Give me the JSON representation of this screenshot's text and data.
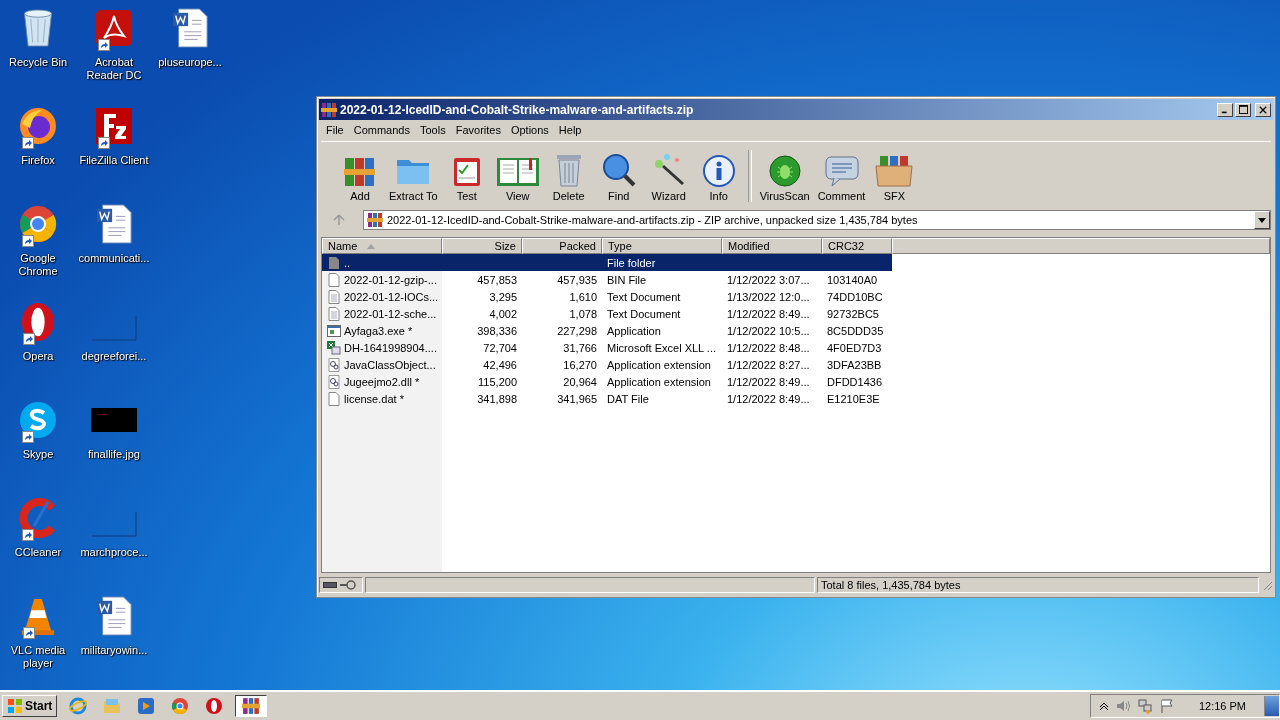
{
  "desktop_icons": [
    {
      "label": "Recycle Bin",
      "kind": "recycle",
      "shortcut": false
    },
    {
      "label": "Firefox",
      "kind": "firefox",
      "shortcut": true
    },
    {
      "label": "Google Chrome",
      "kind": "chrome",
      "shortcut": true
    },
    {
      "label": "Opera",
      "kind": "opera",
      "shortcut": true
    },
    {
      "label": "Skype",
      "kind": "skype",
      "shortcut": true
    },
    {
      "label": "CCleaner",
      "kind": "ccleaner",
      "shortcut": true
    },
    {
      "label": "VLC media player",
      "kind": "vlc",
      "shortcut": true
    },
    {
      "label": "Acrobat Reader DC",
      "kind": "pdf",
      "shortcut": true
    },
    {
      "label": "FileZilla Client",
      "kind": "filezilla",
      "shortcut": true
    },
    {
      "label": "communicati...",
      "kind": "word",
      "shortcut": false
    },
    {
      "label": "degreeforei...",
      "kind": "blank",
      "shortcut": false
    },
    {
      "label": "finallife.jpg",
      "kind": "image",
      "shortcut": false
    },
    {
      "label": "marchproce...",
      "kind": "blank",
      "shortcut": false
    },
    {
      "label": "militaryowin...",
      "kind": "word",
      "shortcut": false
    },
    {
      "label": "pluseurope...",
      "kind": "word",
      "shortcut": false
    }
  ],
  "window": {
    "title": "2022-01-12-IcedID-and-Cobalt-Strike-malware-and-artifacts.zip",
    "menu": [
      "File",
      "Commands",
      "Tools",
      "Favorites",
      "Options",
      "Help"
    ],
    "toolbar": [
      {
        "label": "Add",
        "kind": "add"
      },
      {
        "label": "Extract To",
        "kind": "extract"
      },
      {
        "label": "Test",
        "kind": "test"
      },
      {
        "label": "View",
        "kind": "view"
      },
      {
        "label": "Delete",
        "kind": "delete"
      },
      {
        "label": "Find",
        "kind": "find"
      },
      {
        "label": "Wizard",
        "kind": "wizard"
      },
      {
        "label": "Info",
        "kind": "info"
      },
      {
        "label": "VirusScan",
        "kind": "virus"
      },
      {
        "label": "Comment",
        "kind": "comment"
      },
      {
        "label": "SFX",
        "kind": "sfx"
      }
    ],
    "address": "2022-01-12-IcedID-and-Cobalt-Strike-malware-and-artifacts.zip - ZIP archive, unpacked size 1,435,784 bytes",
    "columns": [
      {
        "label": "Name",
        "sorted": true
      },
      {
        "label": "Size",
        "sorted": false
      },
      {
        "label": "Packed",
        "sorted": false
      },
      {
        "label": "Type",
        "sorted": false
      },
      {
        "label": "Modified",
        "sorted": false
      },
      {
        "label": "CRC32",
        "sorted": false
      }
    ],
    "rows": [
      {
        "kind": "up",
        "name": "..",
        "size": "",
        "packed": "",
        "type": "File folder",
        "modified": "",
        "crc": "",
        "selected": true
      },
      {
        "kind": "file",
        "name": "2022-01-12-gzip-...",
        "size": "457,853",
        "packed": "457,935",
        "type": "BIN File",
        "modified": "1/12/2022 3:07...",
        "crc": "103140A0",
        "selected": false
      },
      {
        "kind": "text",
        "name": "2022-01-12-IOCs...",
        "size": "3,295",
        "packed": "1,610",
        "type": "Text Document",
        "modified": "1/13/2022 12:0...",
        "crc": "74DD10BC",
        "selected": false
      },
      {
        "kind": "text",
        "name": "2022-01-12-sche...",
        "size": "4,002",
        "packed": "1,078",
        "type": "Text Document",
        "modified": "1/12/2022 8:49...",
        "crc": "92732BC5",
        "selected": false
      },
      {
        "kind": "exe",
        "name": "Ayfaga3.exe *",
        "size": "398,336",
        "packed": "227,298",
        "type": "Application",
        "modified": "1/12/2022 10:5...",
        "crc": "8C5DDD35",
        "selected": false
      },
      {
        "kind": "excel",
        "name": "DH-1641998904....",
        "size": "72,704",
        "packed": "31,766",
        "type": "Microsoft Excel XLL ...",
        "modified": "1/12/2022 8:48...",
        "crc": "4F0ED7D3",
        "selected": false
      },
      {
        "kind": "dll",
        "name": "JavaClassObject...",
        "size": "42,496",
        "packed": "16,270",
        "type": "Application extension",
        "modified": "1/12/2022 8:27...",
        "crc": "3DFA23BB",
        "selected": false
      },
      {
        "kind": "dll",
        "name": "Jugeejmo2.dll *",
        "size": "115,200",
        "packed": "20,964",
        "type": "Application extension",
        "modified": "1/12/2022 8:49...",
        "crc": "DFDD1436",
        "selected": false
      },
      {
        "kind": "file",
        "name": "license.dat *",
        "size": "341,898",
        "packed": "341,965",
        "type": "DAT File",
        "modified": "1/12/2022 8:49...",
        "crc": "E1210E3E",
        "selected": false
      }
    ],
    "status": "Total 8 files, 1,435,784 bytes"
  },
  "taskbar": {
    "start": "Start",
    "apps": [
      {
        "kind": "ie",
        "active": false
      },
      {
        "kind": "explorer",
        "active": false
      },
      {
        "kind": "media",
        "active": false
      },
      {
        "kind": "chrome",
        "active": false
      },
      {
        "kind": "opera",
        "active": false
      },
      {
        "kind": "winrar",
        "active": true
      }
    ],
    "clock": "12:16 PM"
  }
}
